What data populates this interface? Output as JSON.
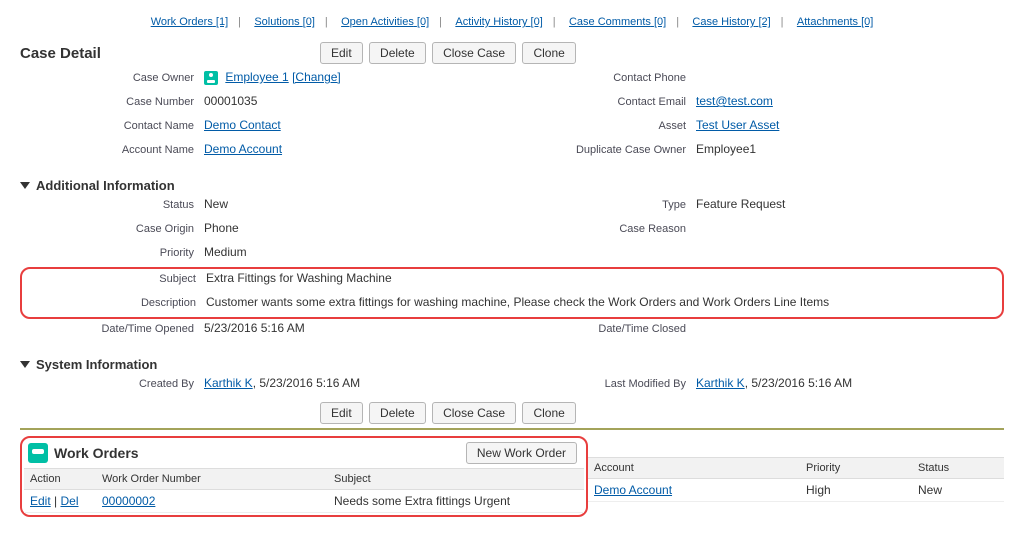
{
  "relatedLinks": [
    {
      "label": "Work Orders",
      "count": "[1]"
    },
    {
      "label": "Solutions",
      "count": "[0]"
    },
    {
      "label": "Open Activities",
      "count": "[0]"
    },
    {
      "label": "Activity History",
      "count": "[0]"
    },
    {
      "label": "Case Comments",
      "count": "[0]"
    },
    {
      "label": "Case History",
      "count": "[2]"
    },
    {
      "label": "Attachments",
      "count": "[0]"
    }
  ],
  "sections": {
    "caseDetailTitle": "Case Detail",
    "additionalInfoTitle": "Additional Information",
    "systemInfoTitle": "System Information"
  },
  "buttons": {
    "edit": "Edit",
    "delete": "Delete",
    "closeCase": "Close Case",
    "clone": "Clone",
    "newWorkOrder": "New Work Order"
  },
  "caseDetail": {
    "labels": {
      "caseOwner": "Case Owner",
      "caseNumber": "Case Number",
      "contactName": "Contact Name",
      "accountName": "Account Name",
      "contactPhone": "Contact Phone",
      "contactEmail": "Contact Email",
      "asset": "Asset",
      "duplicateCaseOwner": "Duplicate Case Owner"
    },
    "caseOwnerLink": "Employee 1",
    "changeLink": "[Change]",
    "caseNumber": "00001035",
    "contactName": "Demo Contact",
    "accountName": "Demo Account",
    "contactPhone": "",
    "contactEmail": "test@test.com",
    "asset": "Test User Asset",
    "duplicateCaseOwner": "Employee1"
  },
  "additionalInfo": {
    "labels": {
      "status": "Status",
      "caseOrigin": "Case Origin",
      "priority": "Priority",
      "subject": "Subject",
      "description": "Description",
      "dateTimeOpened": "Date/Time Opened",
      "type": "Type",
      "caseReason": "Case Reason",
      "dateTimeClosed": "Date/Time Closed"
    },
    "status": "New",
    "caseOrigin": "Phone",
    "priority": "Medium",
    "subject": "Extra Fittings for Washing Machine",
    "description": "Customer wants some extra fittings for washing machine, Please check the Work Orders and Work Orders Line Items",
    "dateTimeOpened": "5/23/2016 5:16 AM",
    "type": "Feature Request",
    "caseReason": "",
    "dateTimeClosed": ""
  },
  "systemInfo": {
    "labels": {
      "createdBy": "Created By",
      "lastModifiedBy": "Last Modified By"
    },
    "createdByUser": "Karthik K",
    "createdByDate": ", 5/23/2016 5:16 AM",
    "lastModifiedByUser": "Karthik K",
    "lastModifiedByDate": ", 5/23/2016 5:16 AM"
  },
  "workOrders": {
    "title": "Work Orders",
    "headers": {
      "action": "Action",
      "workOrderNumber": "Work Order Number",
      "subject": "Subject",
      "account": "Account",
      "priority": "Priority",
      "status": "Status"
    },
    "row": {
      "editLink": "Edit",
      "sep": " | ",
      "delLink": "Del",
      "number": "00000002",
      "subject": "Needs some Extra fittings Urgent",
      "account": "Demo Account",
      "priority": "High",
      "status": "New"
    }
  }
}
